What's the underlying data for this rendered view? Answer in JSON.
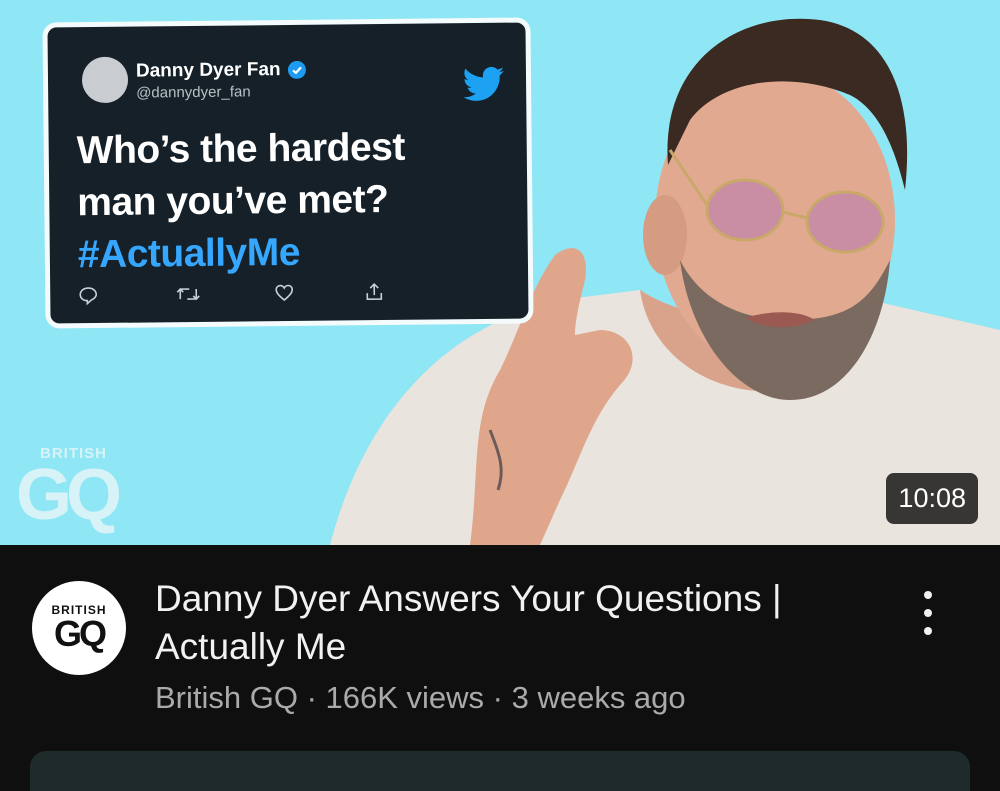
{
  "thumbnail": {
    "tweet": {
      "display_name": "Danny Dyer Fan",
      "handle": "@dannydyer_fan",
      "text_line1": "Who’s the hardest",
      "text_line2": "man you’ve met?",
      "hashtag": "#ActuallyMe",
      "icons": [
        "reply-icon",
        "retweet-icon",
        "like-icon",
        "share-icon"
      ]
    },
    "brand_small": "BRITISH",
    "brand_big": "GQ",
    "duration": "10:08"
  },
  "video": {
    "channel_avatar_small": "BRITISH",
    "channel_avatar_big": "GQ",
    "title": "Danny Dyer Answers Your Questions | Actually Me",
    "meta": "British GQ · 166K views · 3 weeks ago"
  },
  "colors": {
    "thumbnail_bg": "#8fe6f4",
    "tweet_card": "#152028",
    "hashtag": "#36a7ff",
    "page_bg": "#0f0f0f",
    "meta_text": "#aaaaaa"
  }
}
